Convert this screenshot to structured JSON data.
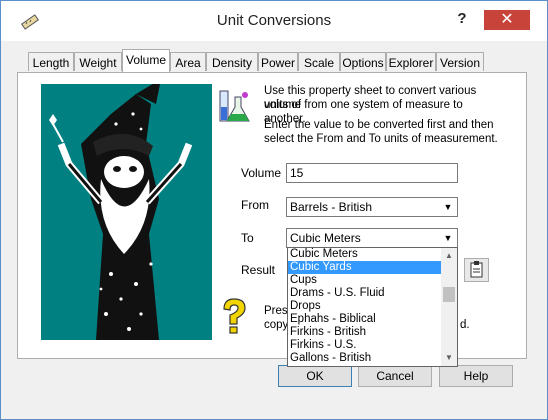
{
  "window": {
    "title": "Unit Conversions",
    "help_label": "?",
    "close_label": "✕"
  },
  "tabs": [
    "Length",
    "Weight",
    "Volume",
    "Area",
    "Density",
    "Power",
    "Scale",
    "Options",
    "Explorer",
    "Version"
  ],
  "active_tab": "Volume",
  "intro": {
    "line1": "Use this property sheet to convert various units of",
    "line2": "volume from one system of measure to another.",
    "line3": "Enter the value to be converted first and then",
    "line4": "select the From and To units of measurement."
  },
  "form": {
    "volume_label": "Volume",
    "volume_value": "15",
    "from_label": "From",
    "from_value": "Barrels - British",
    "to_label": "To",
    "to_value": "Cubic Meters",
    "result_label": "Result"
  },
  "dropdown": {
    "items": [
      "Cubic Meters",
      "Cubic Yards",
      "Cups",
      "Drams - U.S. Fluid",
      "Drops",
      "Ephahs - Biblical",
      "Firkins - British",
      "Firkins - U.S.",
      "Gallons - British"
    ],
    "selected": "Cubic Yards"
  },
  "note": {
    "line1_partial": "Pres",
    "line2_partial": "copy",
    "line2_tail": "d."
  },
  "buttons": {
    "ok": "OK",
    "cancel": "Cancel",
    "help": "Help"
  },
  "icons": {
    "app": "ruler-icon",
    "info": "lab-flask-icon",
    "tip": "question-mark-icon",
    "copy": "clipboard-icon"
  },
  "colors": {
    "wizard_bg": "#008080",
    "selection": "#3399ff",
    "close_button": "#c8443a",
    "window_border": "#5a8fc7"
  }
}
